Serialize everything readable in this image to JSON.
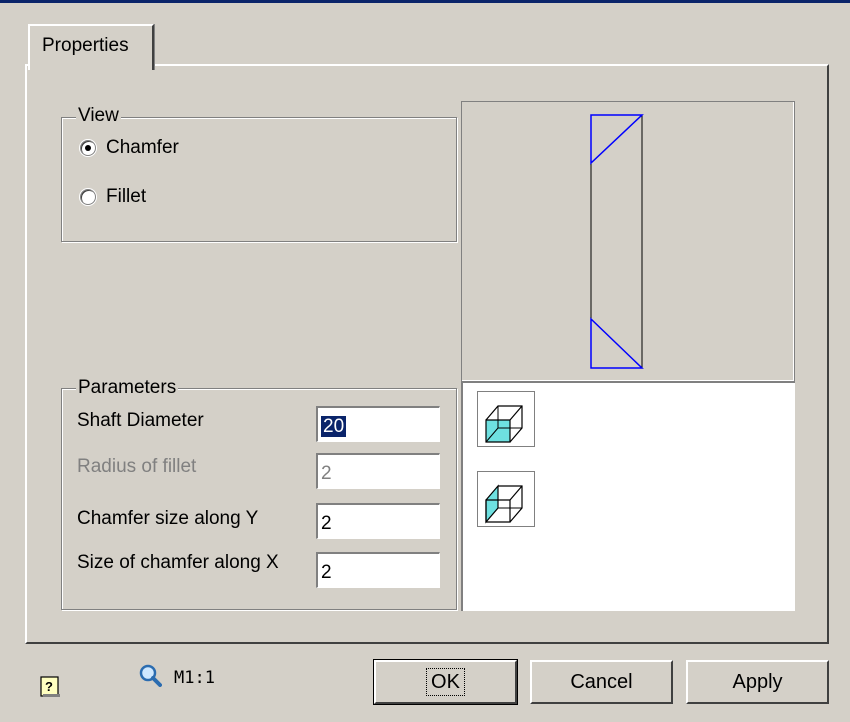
{
  "tabs": [
    {
      "label": "Properties"
    }
  ],
  "view": {
    "legend": "View",
    "options": [
      {
        "label": "Chamfer",
        "selected": true
      },
      {
        "label": "Fillet",
        "selected": false
      }
    ]
  },
  "parameters": {
    "legend": "Parameters",
    "fields": [
      {
        "label": "Shaft Diameter",
        "value": "20",
        "enabled": true,
        "selected_text": true
      },
      {
        "label": "Radius of fillet",
        "value": "2",
        "enabled": false
      },
      {
        "label": "Chamfer size along Y",
        "value": "2",
        "enabled": true
      },
      {
        "label": "Size of chamfer along X",
        "value": "2",
        "enabled": true
      }
    ]
  },
  "preview_icons": [
    "cube-front-face-icon",
    "cube-side-face-icon"
  ],
  "footer": {
    "help_icon": "help-icon",
    "zoom_icon": "magnifier-icon",
    "scale_label": "M1:1",
    "buttons": {
      "ok": "OK",
      "cancel": "Cancel",
      "apply": "Apply"
    }
  },
  "colors": {
    "accent_highlight": "#0a246a",
    "sketch_lines": "#0000ff",
    "cube_fill": "#6ee0e0"
  }
}
